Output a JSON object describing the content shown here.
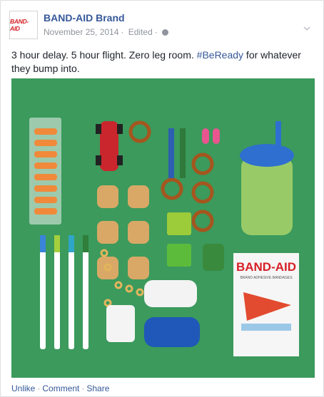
{
  "post": {
    "page_name": "BAND-AID Brand",
    "avatar_logo_text": "BAND-AID",
    "date": "November 25, 2014",
    "edited_label": "Edited",
    "text_before_tag": "3 hour delay. 5 hour flight. Zero leg room. ",
    "hashtag": "#BeReady",
    "text_after_tag": " for whatever they bump into.",
    "photo_box_label": "BAND-AID",
    "photo_box_sublabel": "BRAND ADHESIVE BANDAGES"
  },
  "actions": {
    "unlike": "Unlike",
    "comment": "Comment",
    "share": "Share",
    "separator": "·"
  },
  "colors": {
    "link": "#365899",
    "meta": "#90949c",
    "photo_background": "#3b9a5c",
    "brand_red": "#d61f26"
  }
}
